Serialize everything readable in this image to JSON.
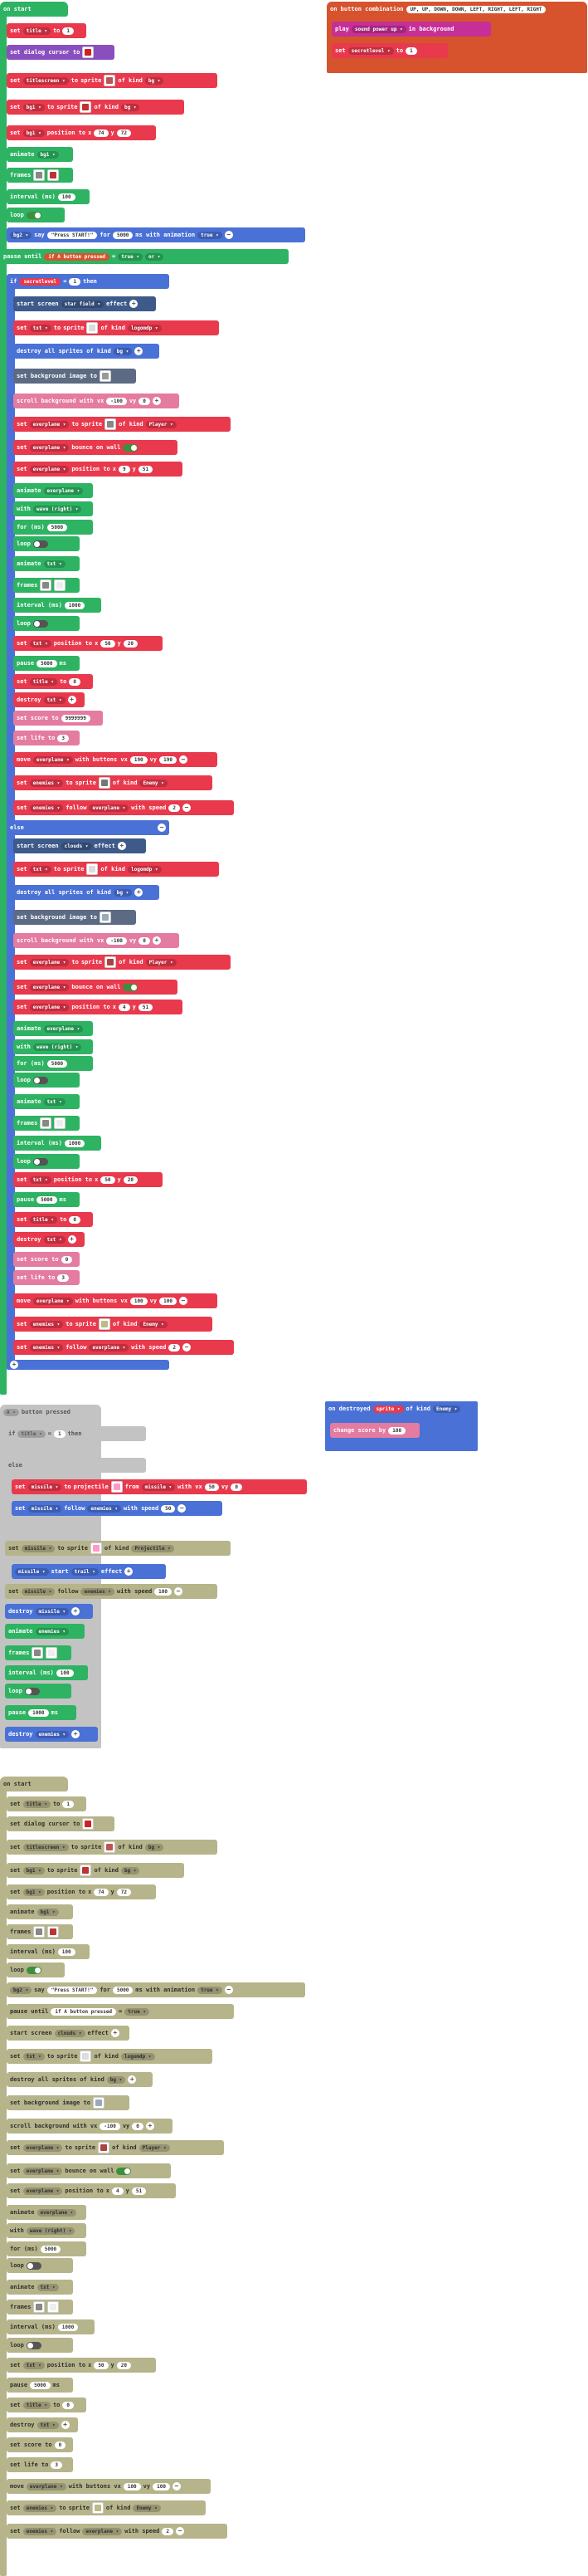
{
  "colors": {
    "loops_green": "#2eb363",
    "sprites_red": "#e8394d",
    "scene_blue": "#4a71d6",
    "disabled_gold": "#b6b48a",
    "disabled_silver": "#c3c3c3",
    "controller_orange": "#d6532e",
    "music_magenta": "#c62f96"
  },
  "labels": {
    "on_start": "on start",
    "set": "set",
    "to": "to",
    "sprite": "sprite",
    "of_kind": "of kind",
    "position_to": "position to",
    "x": "x",
    "y": "y",
    "animate": "animate",
    "frames": "frames",
    "interval_ms": "interval (ms)",
    "loop": "loop",
    "say": "say",
    "for": "for",
    "ms_with_animation": "ms with animation",
    "pause_until": "pause until",
    "button_pressed": "button pressed",
    "eq": "=",
    "or": "or",
    "if": "if",
    "then": "then",
    "else": "else",
    "start_screen": "start screen",
    "effect": "effect",
    "destroy_all_sprites_of_kind": "destroy all sprites of kind",
    "set_background_image_to": "set background image to",
    "scroll_background_with_vx": "scroll background with vx",
    "vy": "vy",
    "bounce_on_wall": "bounce on wall",
    "with_wave_right": "with",
    "for_ms": "for (ms)",
    "pause": "pause",
    "ms": "ms",
    "destroy": "destroy",
    "set_score_to": "set score to",
    "set_life_to": "set life to",
    "move": "move",
    "with_buttons_vx": "with buttons vx",
    "follow": "follow",
    "with_speed": "with speed",
    "set_dialog_cursor_to": "set dialog cursor to",
    "on_button_combination": "on button combination",
    "play": "play",
    "in_background": "in background",
    "on_destroyed": "on destroyed",
    "change_score_by": "change score by",
    "projectile": "projectile",
    "from": "from",
    "with_vx": "with vx",
    "start": "start"
  },
  "vars": {
    "title": "title",
    "titlescreen": "titlescreen",
    "bg1": "bg1",
    "bg2": "bg2",
    "secretlevel": "secretlevel",
    "txt": "txt",
    "everplane": "everplane",
    "enemies": "enemies",
    "missile": "missile",
    "trail": "trail"
  },
  "kinds": {
    "bg": "bg",
    "logomdp": "logomdp",
    "player": "Player",
    "enemy": "Enemy",
    "projectile": "Projectile"
  },
  "values": {
    "zero": "0",
    "one": "1",
    "two": "2",
    "four": "4",
    "five": "5",
    "nine": "9",
    "ten": "10",
    "twenty": "20",
    "seventy_four": "74",
    "seventy_two": "72",
    "fifty_one": "51",
    "two_twenty": "220",
    "fifty": "50",
    "one_hundred": "100",
    "hundred_neg": "-100",
    "neg_hundred_alt": "-30",
    "thousand": "1000",
    "five_thousand": "5000",
    "one_fifty": "150",
    "one_ninety": "190",
    "two_hundred": "200",
    "score_large": "9999999",
    "three": "3",
    "eighty_alt": "80",
    "two_four": "24",
    "forty_four": "44",
    "press_start": "\"Press START!\""
  },
  "dropdowns": {
    "true": "true",
    "star_field": "star field",
    "clouds": "clouds",
    "wave_right": "wave (right)",
    "a": "A",
    "any": "any",
    "sound_power_up": "sound power up",
    "dot": "a"
  },
  "combo": "UP, UP, DOWN, DOWN, LEFT, RIGHT, LEFT, RIGHT"
}
